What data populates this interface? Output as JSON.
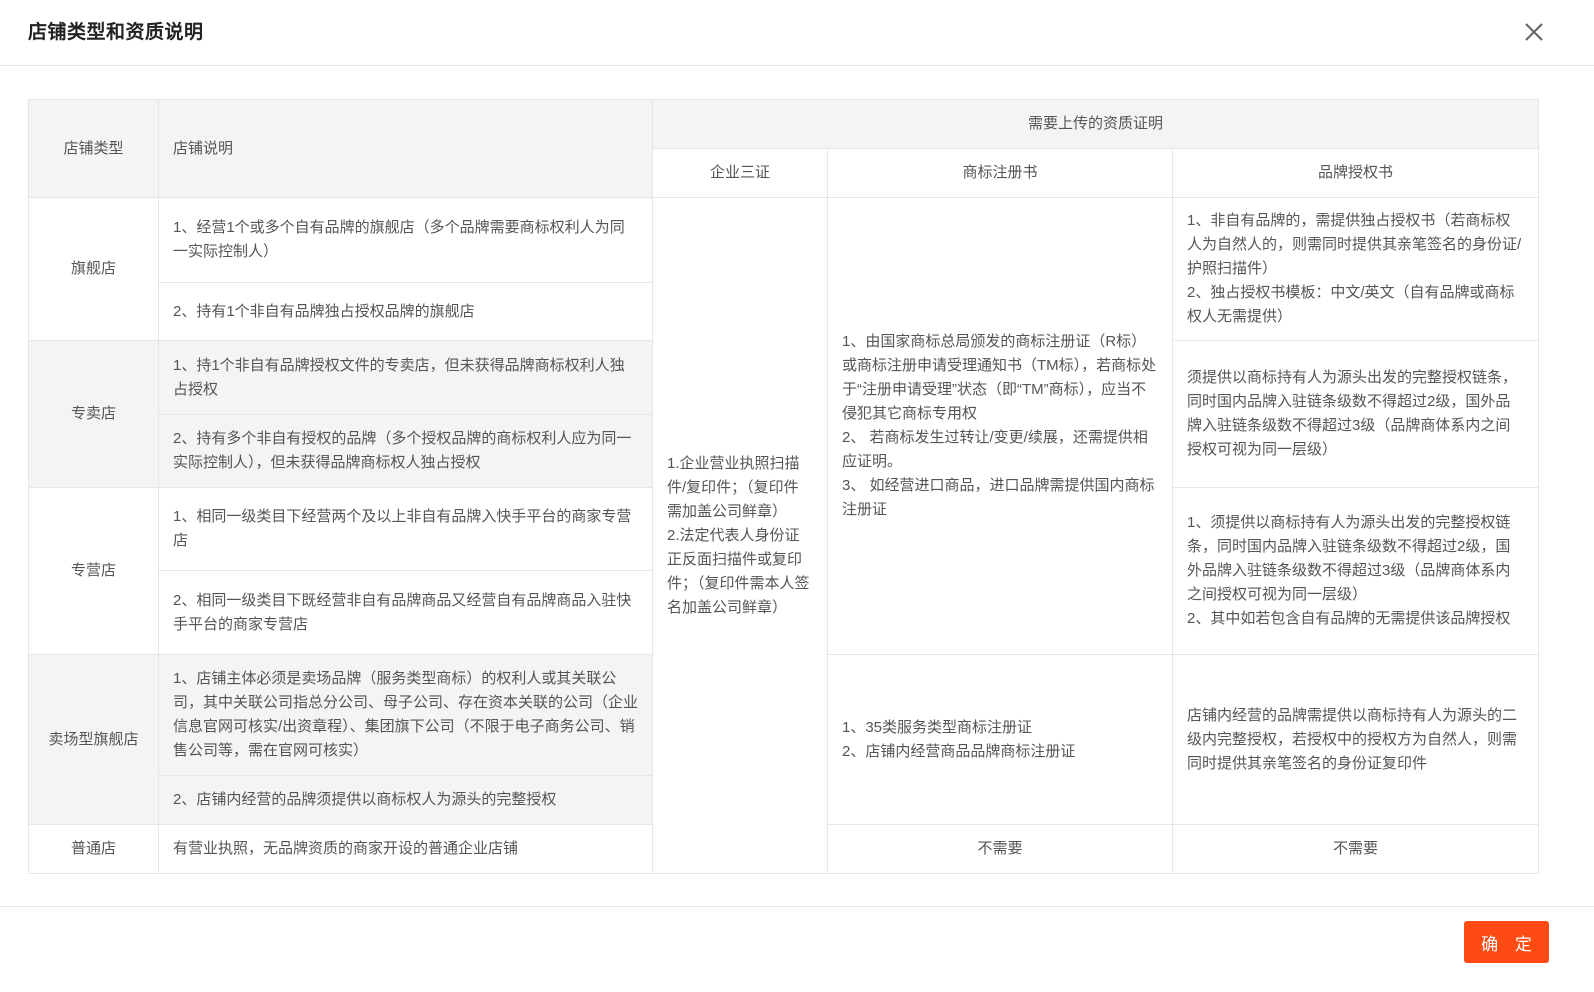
{
  "dialog": {
    "title": "店铺类型和资质说明",
    "confirm_label": "确 定"
  },
  "table": {
    "headers": {
      "type": "店铺类型",
      "desc": "店铺说明",
      "required": "需要上传的资质证明",
      "cert": "企业三证",
      "trademark": "商标注册书",
      "auth": "品牌授权书"
    },
    "cert_content": "1.企业营业执照扫描件/复印件；（复印件需加盖公司鲜章）\n2.法定代表人身份证正反面扫描件或复印件；（复印件需本人签名加盖公司鲜章）",
    "rows": {
      "flagship": {
        "type": "旗舰店",
        "desc1": "1、经营1个或多个自有品牌的旗舰店（多个品牌需要商标权利人为同一实际控制人）",
        "desc2": "2、持有1个非自有品牌独占授权品牌的旗舰店",
        "auth": "1、非自有品牌的，需提供独占授权书（若商标权人为自然人的，则需同时提供其亲笔签名的身份证/护照扫描件）\n2、独占授权书模板：中文/英文（自有品牌或商标权人无需提供）"
      },
      "specialty": {
        "type": "专卖店",
        "desc1": "1、持1个非自有品牌授权文件的专卖店，但未获得品牌商标权利人独占授权",
        "desc2": "2、持有多个非自有授权的品牌（多个授权品牌的商标权利人应为同一实际控制人），但未获得品牌商标权人独占授权",
        "auth": "须提供以商标持有人为源头出发的完整授权链条，同时国内品牌入驻链条级数不得超过2级，国外品牌入驻链条级数不得超过3级（品牌商体系内之间授权可视为同一层级）"
      },
      "franchise": {
        "type": "专营店",
        "desc1": "1、相同一级类目下经营两个及以上非自有品牌入快手平台的商家专营店",
        "desc2": "2、相同一级类目下既经营非自有品牌商品又经营自有品牌商品入驻快手平台的商家专营店",
        "auth": "1、须提供以商标持有人为源头出发的完整授权链条，同时国内品牌入驻链条级数不得超过2级，国外品牌入驻链条级数不得超过3级（品牌商体系内之间授权可视为同一层级）\n2、其中如若包含自有品牌的无需提供该品牌授权"
      },
      "trademark_shared": "1、由国家商标总局颁发的商标注册证（R标）或商标注册申请受理通知书（TM标），若商标处于“注册申请受理”状态（即“TM”商标），应当不侵犯其它商标专用权\n2、 若商标发生过转让/变更/续展，还需提供相应证明。\n3、 如经营进口商品，进口品牌需提供国内商标注册证",
      "mall": {
        "type": "卖场型旗舰店",
        "desc1": "1、店铺主体必须是卖场品牌（服务类型商标）的权利人或其关联公司，其中关联公司指总分公司、母子公司、存在资本关联的公司（企业信息官网可核实/出资章程）、集团旗下公司（不限于电子商务公司、销售公司等，需在官网可核实）",
        "desc2": "2、店铺内经营的品牌须提供以商标权人为源头的完整授权",
        "trademark": "1、35类服务类型商标注册证\n2、店铺内经营商品品牌商标注册证",
        "auth": "店铺内经营的品牌需提供以商标持有人为源头的二级内完整授权，若授权中的授权方为自然人，则需同时提供其亲笔签名的身份证复印件"
      },
      "ordinary": {
        "type": "普通店",
        "desc": "有营业执照，无品牌资质的商家开设的普通企业店铺",
        "trademark": "不需要",
        "auth": "不需要"
      }
    }
  },
  "icons": {
    "close": "close-icon"
  },
  "colors": {
    "primary": "#fe4b13",
    "header_bg": "#f4f4f4",
    "border": "#e6e6e6"
  }
}
